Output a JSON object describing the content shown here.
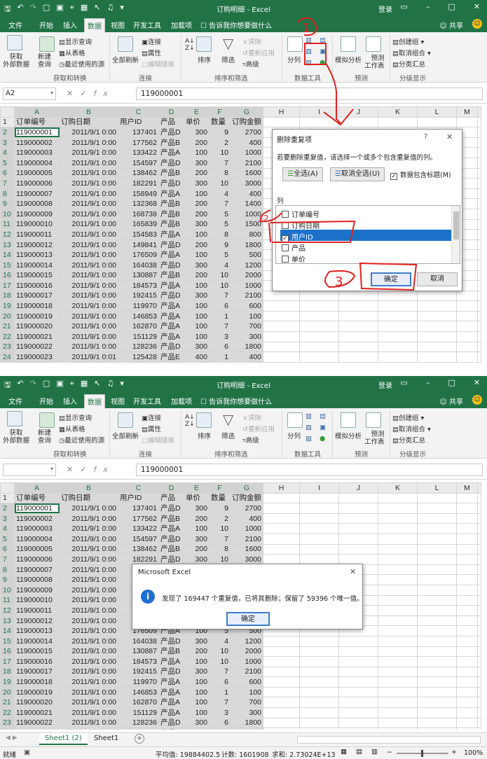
{
  "app": {
    "title": "订购明细 - Excel",
    "login": "登录",
    "share": "共享",
    "tell_me": "告诉我你想要做什么",
    "tabs": [
      "文件",
      "开始",
      "插入",
      "数据",
      "视图",
      "开发工具",
      "加载项"
    ],
    "active_tab": "数据",
    "accent_color": "#217346"
  },
  "ribbon": {
    "get_external_data": "获取\n外部数据",
    "new_query": "新建\n查询",
    "show_queries": "显示查询",
    "from_table": "从表格",
    "recent_sources": "最近使用的源",
    "group_get_transform": "获取和转换",
    "refresh_all": "全部刷新",
    "connections": "连接",
    "properties": "属性",
    "edit_links": "编辑链接",
    "group_connections": "连接",
    "sort": "排序",
    "filter": "筛选",
    "clear": "清除",
    "reapply": "重新应用",
    "advanced": "高级",
    "group_sort_filter": "排序和筛选",
    "split": "分列",
    "group_data_tools": "数据工具",
    "what_if": "模拟分析",
    "forecast_sheet": "预测\n工作表",
    "group_forecast": "预测",
    "group": "创建组",
    "ungroup": "取消组合",
    "subtotal": "分类汇总",
    "group_outline": "分级显示"
  },
  "screen1": {
    "name_box": "A2",
    "formula": "119000001"
  },
  "screen2": {
    "name_box": "",
    "formula": "119000001"
  },
  "sheet": {
    "col_letters": [
      "A",
      "B",
      "C",
      "D",
      "E",
      "F",
      "G",
      "H",
      "I",
      "J",
      "K",
      "L",
      "M"
    ],
    "headers": [
      "订单编号",
      "订购日期",
      "用户ID",
      "产品",
      "单价",
      "数量",
      "订购金额"
    ],
    "rows": [
      [
        "119000001",
        "2011/9/1 0:00",
        "137401",
        "产品D",
        "300",
        "9",
        "2700"
      ],
      [
        "119000002",
        "2011/9/1 0:00",
        "177562",
        "产品B",
        "200",
        "2",
        "400"
      ],
      [
        "119000003",
        "2011/9/1 0:00",
        "133422",
        "产品A",
        "100",
        "10",
        "1000"
      ],
      [
        "119000004",
        "2011/9/1 0:00",
        "154597",
        "产品D",
        "300",
        "7",
        "2100"
      ],
      [
        "119000005",
        "2011/9/1 0:00",
        "138462",
        "产品B",
        "200",
        "8",
        "1600"
      ],
      [
        "119000006",
        "2011/9/1 0:00",
        "182291",
        "产品D",
        "300",
        "10",
        "3000"
      ],
      [
        "119000007",
        "2011/9/1 0:00",
        "158949",
        "产品A",
        "100",
        "4",
        "400"
      ],
      [
        "119000008",
        "2011/9/1 0:00",
        "132368",
        "产品B",
        "200",
        "7",
        "1400"
      ],
      [
        "119000009",
        "2011/9/1 0:00",
        "168738",
        "产品B",
        "200",
        "5",
        "1000"
      ],
      [
        "119000010",
        "2011/9/1 0:00",
        "165839",
        "产品B",
        "300",
        "5",
        "1500"
      ],
      [
        "119000011",
        "2011/9/1 0:00",
        "154583",
        "产品A",
        "100",
        "8",
        "800"
      ],
      [
        "119000012",
        "2011/9/1 0:00",
        "149841",
        "产品D",
        "200",
        "9",
        "1800"
      ],
      [
        "119000013",
        "2011/9/1 0:00",
        "176509",
        "产品A",
        "100",
        "5",
        "500"
      ],
      [
        "119000014",
        "2011/9/1 0:00",
        "164038",
        "产品D",
        "300",
        "4",
        "1200"
      ],
      [
        "119000015",
        "2011/9/1 0:00",
        "130887",
        "产品B",
        "200",
        "10",
        "2000"
      ],
      [
        "119000016",
        "2011/9/1 0:00",
        "184573",
        "产品A",
        "100",
        "10",
        "1000"
      ],
      [
        "119000017",
        "2011/9/1 0:00",
        "192415",
        "产品D",
        "300",
        "7",
        "2100"
      ],
      [
        "119000018",
        "2011/9/1 0:00",
        "119970",
        "产品A",
        "100",
        "6",
        "600"
      ],
      [
        "119000019",
        "2011/9/1 0:00",
        "146853",
        "产品A",
        "100",
        "1",
        "100"
      ],
      [
        "119000020",
        "2011/9/1 0:00",
        "162870",
        "产品A",
        "100",
        "7",
        "700"
      ],
      [
        "119000021",
        "2011/9/1 0:00",
        "151129",
        "产品A",
        "100",
        "3",
        "300"
      ],
      [
        "119000022",
        "2011/9/1 0:00",
        "128236",
        "产品D",
        "300",
        "6",
        "1800"
      ],
      [
        "119000023",
        "2011/9/1 0:01",
        "125428",
        "产品E",
        "400",
        "1",
        "400"
      ]
    ]
  },
  "remove_dup_dialog": {
    "title": "删除重复项",
    "help": "?",
    "instruction": "若要删除重复值，请选择一个或多个包含重复值的列。",
    "select_all": "全选(A)",
    "unselect_all": "取消全选(U)",
    "has_headers": "数据包含标题(M)",
    "columns_label": "列",
    "columns": [
      "订单编号",
      "订购日期",
      "用户ID",
      "产品",
      "单价"
    ],
    "checked_index": 2,
    "ok": "确定",
    "cancel": "取消"
  },
  "result_dialog": {
    "title": "Microsoft Excel",
    "message": "发现了 169447 个重复值，已将其删除；保留了 59396 个唯一值。",
    "ok": "确定"
  },
  "sheet_tabs": [
    "Sheet1 (2)",
    "Sheet1"
  ],
  "status": {
    "ready": "就绪",
    "average": "平均值: 19884402.5",
    "count": "计数: 1601908",
    "sum": "求和: 2.73024E+13",
    "zoom": "100%"
  },
  "annotations": [
    "1",
    "2",
    "3"
  ]
}
